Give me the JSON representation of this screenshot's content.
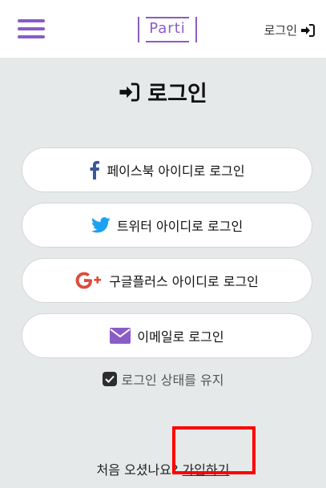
{
  "header": {
    "logo_text": "Parti",
    "login_label": "로그인",
    "icons": [
      "menu-icon",
      "sign-in-icon"
    ]
  },
  "main": {
    "title": "로그인",
    "buttons": [
      {
        "label": "페이스북 아이디로 로그인",
        "icon": "facebook-icon"
      },
      {
        "label": "트위터 아이디로 로그인",
        "icon": "twitter-icon"
      },
      {
        "label": "구글플러스 아이디로 로그인",
        "icon": "google-plus-icon"
      },
      {
        "label": "이메일로 로그인",
        "icon": "email-icon"
      }
    ],
    "keep_logged_in": {
      "label": "로그인 상태를 유지",
      "checked": true
    },
    "signup_prompt": "처음 오셨나요?",
    "signup_link": "가입하기"
  },
  "colors": {
    "brand_purple": "#8b5cc7",
    "facebook": "#3b5998",
    "twitter": "#1da1f2",
    "google_plus": "#dd4b39",
    "email": "#8b5cc7",
    "highlight": "#ff0000"
  }
}
